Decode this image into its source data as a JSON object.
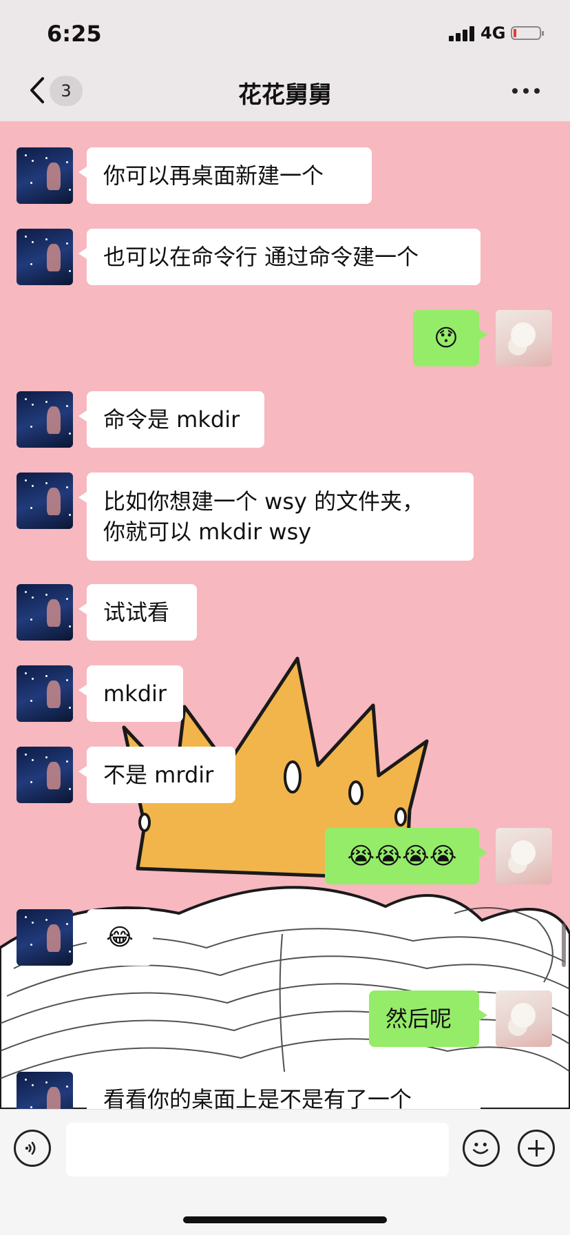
{
  "status": {
    "time": "6:25",
    "network": "4G"
  },
  "header": {
    "unread_count": "3",
    "title": "花花舅舅"
  },
  "messages": [
    {
      "side": "left",
      "text": "你可以再桌面新建一个"
    },
    {
      "side": "left",
      "text": "也可以在命令行 通过命令建一个"
    },
    {
      "side": "right",
      "text": "😯"
    },
    {
      "side": "left",
      "text": "命令是 mkdir"
    },
    {
      "side": "left",
      "text": "比如你想建一个 wsy 的文件夹，\n 你就可以 mkdir wsy"
    },
    {
      "side": "left",
      "text": "试试看"
    },
    {
      "side": "left",
      "text": "mkdir"
    },
    {
      "side": "left",
      "text": "不是 mrdir"
    },
    {
      "side": "right",
      "text": "😭😭😭😭"
    },
    {
      "side": "left",
      "text": "😂"
    },
    {
      "side": "right",
      "text": "然后呢"
    },
    {
      "side": "left",
      "text": "看看你的桌面上是不是有了一个"
    }
  ],
  "input": {
    "placeholder": ""
  },
  "colors": {
    "chat_bg": "#f7b8bf",
    "bubble_mine": "#95ec69",
    "bubble_other": "#ffffff"
  }
}
